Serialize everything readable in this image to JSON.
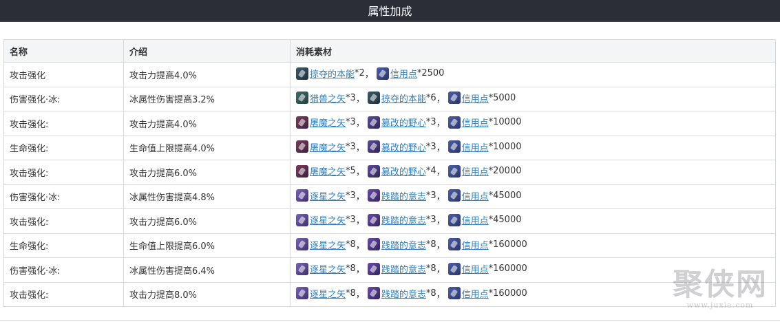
{
  "header": {
    "title": "属性加成"
  },
  "table": {
    "headers": [
      "名称",
      "介绍",
      "消耗素材"
    ],
    "rows": [
      {
        "name": "攻击强化",
        "desc": "攻击力提高4.0%",
        "materials": [
          {
            "icon": "plunder-instinct-icon",
            "label": "掠夺的本能",
            "qty": "*2"
          },
          {
            "icon": "credit-icon",
            "label": "信用点",
            "qty": "*2500"
          }
        ]
      },
      {
        "name": "伤害强化·冰:",
        "desc": "冰属性伤害提高3.2%",
        "materials": [
          {
            "icon": "hunter-arrow-icon",
            "label": "猎兽之矢",
            "qty": "*3"
          },
          {
            "icon": "plunder-instinct-icon",
            "label": "掠夺的本能",
            "qty": "*6"
          },
          {
            "icon": "credit-icon",
            "label": "信用点",
            "qty": "*5000"
          }
        ]
      },
      {
        "name": "攻击强化:",
        "desc": "攻击力提高4.0%",
        "materials": [
          {
            "icon": "demon-slayer-arrow-icon",
            "label": "屠魔之矢",
            "qty": "*3"
          },
          {
            "icon": "usurped-ambition-icon",
            "label": "篡改的野心",
            "qty": "*3"
          },
          {
            "icon": "credit-icon",
            "label": "信用点",
            "qty": "*10000"
          }
        ]
      },
      {
        "name": "生命强化:",
        "desc": "生命值上限提高4.0%",
        "materials": [
          {
            "icon": "demon-slayer-arrow-icon",
            "label": "屠魔之矢",
            "qty": "*3"
          },
          {
            "icon": "usurped-ambition-icon",
            "label": "篡改的野心",
            "qty": "*3"
          },
          {
            "icon": "credit-icon",
            "label": "信用点",
            "qty": "*10000"
          }
        ]
      },
      {
        "name": "攻击强化:",
        "desc": "攻击力提高6.0%",
        "materials": [
          {
            "icon": "demon-slayer-arrow-icon",
            "label": "屠魔之矢",
            "qty": "*5"
          },
          {
            "icon": "usurped-ambition-icon",
            "label": "篡改的野心",
            "qty": "*4"
          },
          {
            "icon": "credit-icon",
            "label": "信用点",
            "qty": "*20000"
          }
        ]
      },
      {
        "name": "伤害强化·冰:",
        "desc": "冰属性伤害提高4.8%",
        "materials": [
          {
            "icon": "star-chaser-arrow-icon",
            "label": "逐星之矢",
            "qty": "*3"
          },
          {
            "icon": "trampled-will-icon",
            "label": "践踏的意志",
            "qty": "*3"
          },
          {
            "icon": "credit-icon",
            "label": "信用点",
            "qty": "*45000"
          }
        ]
      },
      {
        "name": "攻击强化:",
        "desc": "攻击力提高6.0%",
        "materials": [
          {
            "icon": "star-chaser-arrow-icon",
            "label": "逐星之矢",
            "qty": "*3"
          },
          {
            "icon": "trampled-will-icon",
            "label": "践踏的意志",
            "qty": "*3"
          },
          {
            "icon": "credit-icon",
            "label": "信用点",
            "qty": "*45000"
          }
        ]
      },
      {
        "name": "生命强化:",
        "desc": "生命值上限提高6.0%",
        "materials": [
          {
            "icon": "star-chaser-arrow-icon",
            "label": "逐星之矢",
            "qty": "*8"
          },
          {
            "icon": "trampled-will-icon",
            "label": "践踏的意志",
            "qty": "*8"
          },
          {
            "icon": "credit-icon",
            "label": "信用点",
            "qty": "*160000"
          }
        ]
      },
      {
        "name": "伤害强化·冰:",
        "desc": "冰属性伤害提高6.4%",
        "materials": [
          {
            "icon": "star-chaser-arrow-icon",
            "label": "逐星之矢",
            "qty": "*8"
          },
          {
            "icon": "trampled-will-icon",
            "label": "践踏的意志",
            "qty": "*8"
          },
          {
            "icon": "credit-icon",
            "label": "信用点",
            "qty": "*160000"
          }
        ]
      },
      {
        "name": "攻击强化:",
        "desc": "攻击力提高8.0%",
        "materials": [
          {
            "icon": "star-chaser-arrow-icon",
            "label": "逐星之矢",
            "qty": "*8"
          },
          {
            "icon": "trampled-will-icon",
            "label": "践踏的意志",
            "qty": "*8"
          },
          {
            "icon": "credit-icon",
            "label": "信用点",
            "qty": "*160000"
          }
        ]
      }
    ]
  },
  "separator": "，",
  "watermark": {
    "main": "聚侠网",
    "sub": "www.juxia.com"
  },
  "colors": {
    "title_bar": "#2b2e36",
    "link": "#2f80c0",
    "header_bg": "#f4f5f7",
    "border": "#d6d9dd"
  }
}
